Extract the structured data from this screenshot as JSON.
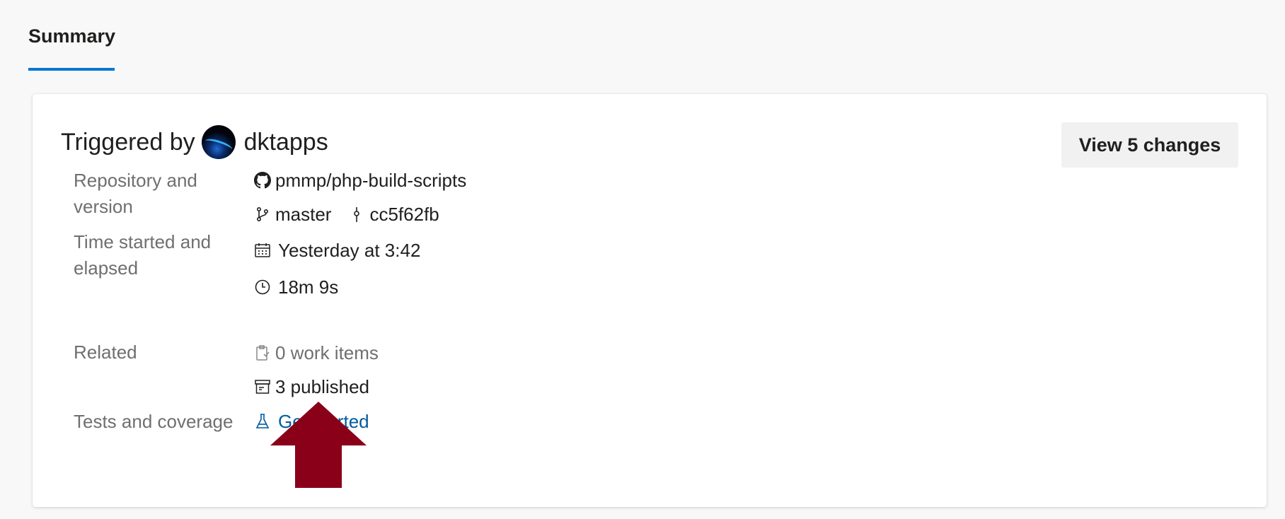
{
  "tabs": [
    {
      "label": "Summary",
      "active": true
    }
  ],
  "summary": {
    "trigger_prefix": "Triggered by",
    "trigger_user": "dktapps",
    "view_changes_label": "View 5 changes",
    "rows": {
      "repository": {
        "label": "Repository and version",
        "repo": "pmmp/php-build-scripts",
        "branch": "master",
        "commit": "cc5f62fb"
      },
      "time": {
        "label": "Time started and elapsed",
        "started": "Yesterday at 3:42",
        "elapsed": "18m 9s"
      },
      "related": {
        "label": "Related",
        "work_items": "0 work items",
        "published": "3 published"
      },
      "tests": {
        "label": "Tests and coverage",
        "link": "Get started"
      }
    }
  },
  "icons": {
    "repo": "github-icon",
    "branch": "branch-icon",
    "commit": "commit-icon",
    "calendar": "calendar-icon",
    "clock": "clock-icon",
    "work_items": "clipboard-icon",
    "published": "artifact-icon",
    "tests": "flask-icon"
  },
  "colors": {
    "accent": "#0078d4",
    "link": "#005a9e",
    "annotation_arrow": "#8b0019"
  }
}
